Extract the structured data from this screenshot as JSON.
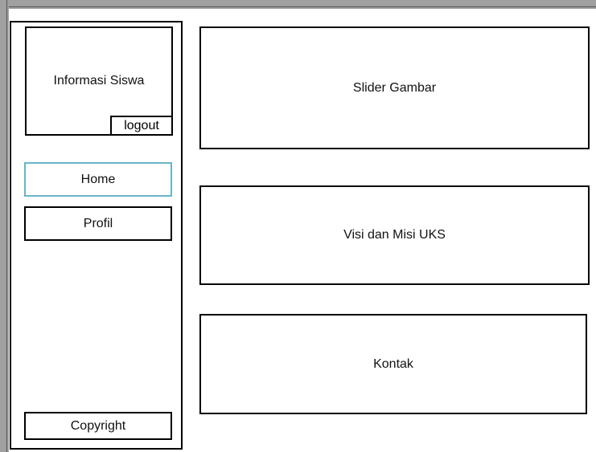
{
  "sidebar": {
    "info_title": "Informasi Siswa",
    "logout_label": "logout",
    "nav": {
      "home_label": "Home",
      "profil_label": "Profil"
    },
    "footer_label": "Copyright"
  },
  "main": {
    "slider_label": "Slider Gambar",
    "visi_label": "Visi dan Misi UKS",
    "kontak_label": "Kontak"
  },
  "colors": {
    "border": "#000000",
    "active_nav_border": "#6ab4c8",
    "frame": "#a0a0a0"
  }
}
